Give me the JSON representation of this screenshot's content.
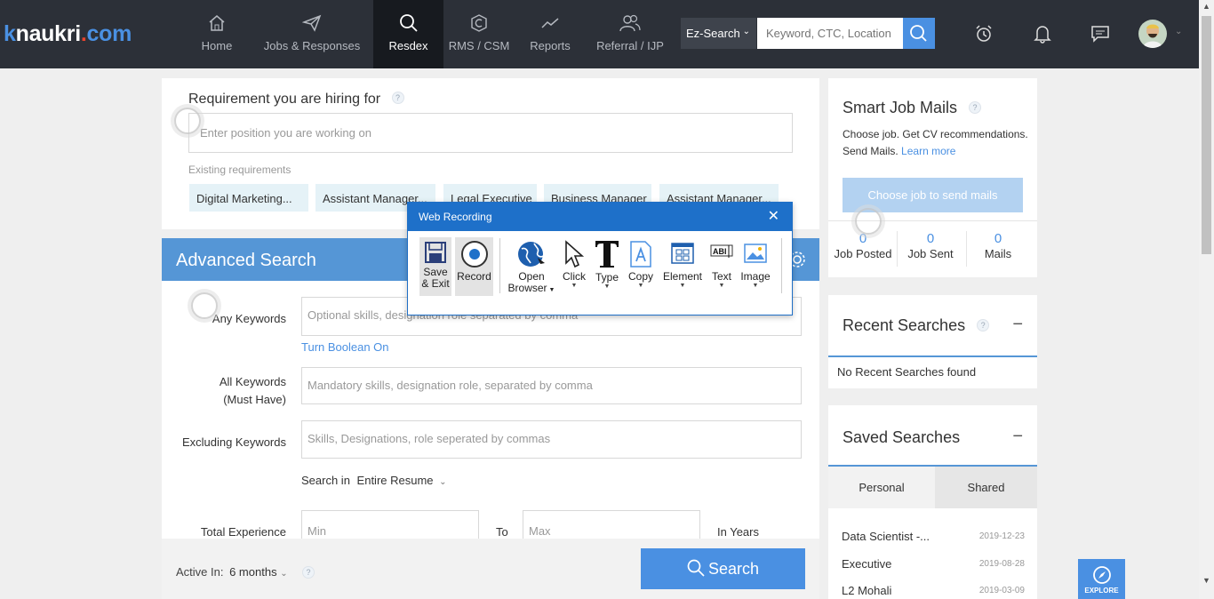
{
  "header": {
    "logo_k": "k",
    "logo_naukri": "naukri",
    "logo_dot": ".",
    "logo_com": "com",
    "nav": [
      {
        "label": "Home",
        "icon": "home-icon"
      },
      {
        "label": "Jobs & Responses",
        "icon": "paper-plane-icon"
      },
      {
        "label": "Resdex",
        "icon": "search-icon"
      },
      {
        "label": "RMS / CSM",
        "icon": "rms-icon"
      },
      {
        "label": "Reports",
        "icon": "chart-line-icon"
      },
      {
        "label": "Referral / IJP",
        "icon": "people-icon"
      }
    ],
    "search_mode": "Ez-Search",
    "search_placeholder": "Keyword, CTC, Location"
  },
  "requirement": {
    "title": "Requirement you are hiring for",
    "help": "?",
    "input_placeholder": "Enter position you are working on",
    "existing_label": "Existing requirements",
    "chips": [
      "Digital Marketing...",
      "Assistant Manager...",
      "Legal Executive",
      "Business Manager",
      "Assistant Manager..."
    ]
  },
  "advanced": {
    "title": "Advanced Search",
    "any_keywords_label": "Any Keywords",
    "any_keywords_placeholder": "Optional skills, designation role separated by comma",
    "boolean_link": "Turn Boolean On",
    "all_keywords_label_1": "All Keywords",
    "all_keywords_label_2": "(Must Have)",
    "all_keywords_placeholder": "Mandatory skills, designation role, separated by comma",
    "excluding_label": "Excluding Keywords",
    "excluding_placeholder": "Skills, Designations, role seperated by commas",
    "search_in_label": "Search in",
    "search_in_value": "Entire Resume",
    "experience_label": "Total Experience",
    "min_placeholder": "Min",
    "to_label": "To",
    "max_placeholder": "Max",
    "years_label": "In Years",
    "active_label": "Active In:",
    "active_value": "6 months",
    "help": "?",
    "search_button": "Search"
  },
  "smart_mails": {
    "title": "Smart Job Mails",
    "help": "?",
    "desc": "Choose job. Get CV recommendations. Send Mails.",
    "learn_more": "Learn more",
    "button": "Choose job to send mails",
    "stats": [
      {
        "value": "0",
        "label": "Job Posted"
      },
      {
        "value": "0",
        "label": "Job Sent"
      },
      {
        "value": "0",
        "label": "Mails"
      }
    ]
  },
  "recent_searches": {
    "title": "Recent Searches",
    "help": "?",
    "collapse": "−",
    "empty": "No Recent Searches found"
  },
  "saved_searches": {
    "title": "Saved Searches",
    "collapse": "−",
    "tabs": [
      "Personal",
      "Shared"
    ],
    "items": [
      {
        "name": "Data Scientist -...",
        "date": "2019-12-23"
      },
      {
        "name": "Executive",
        "date": "2019-08-28"
      },
      {
        "name": "L2 Mohali",
        "date": "2019-03-09"
      }
    ]
  },
  "explore": "EXPLORE",
  "web_recording": {
    "title": "Web Recording",
    "close": "✕",
    "tools": [
      {
        "label_1": "Save",
        "label_2": "& Exit",
        "icon": "save-icon"
      },
      {
        "label_1": "Record",
        "icon": "record-icon"
      },
      {
        "label_1": "Open",
        "label_2": "Browser",
        "icon": "globe-icon"
      },
      {
        "label_1": "Click",
        "icon": "cursor-icon"
      },
      {
        "label_1": "Type",
        "icon": "type-icon"
      },
      {
        "label_1": "Copy",
        "icon": "copy-icon"
      },
      {
        "label_1": "Element",
        "icon": "element-icon"
      },
      {
        "label_1": "Text",
        "icon": "text-icon"
      },
      {
        "label_1": "Image",
        "icon": "image-icon"
      }
    ]
  },
  "colors": {
    "nav_bg": "#2c3038",
    "accent": "#4a90e2",
    "adv_header": "#5596d6",
    "dialog_title": "#1e70c9"
  }
}
